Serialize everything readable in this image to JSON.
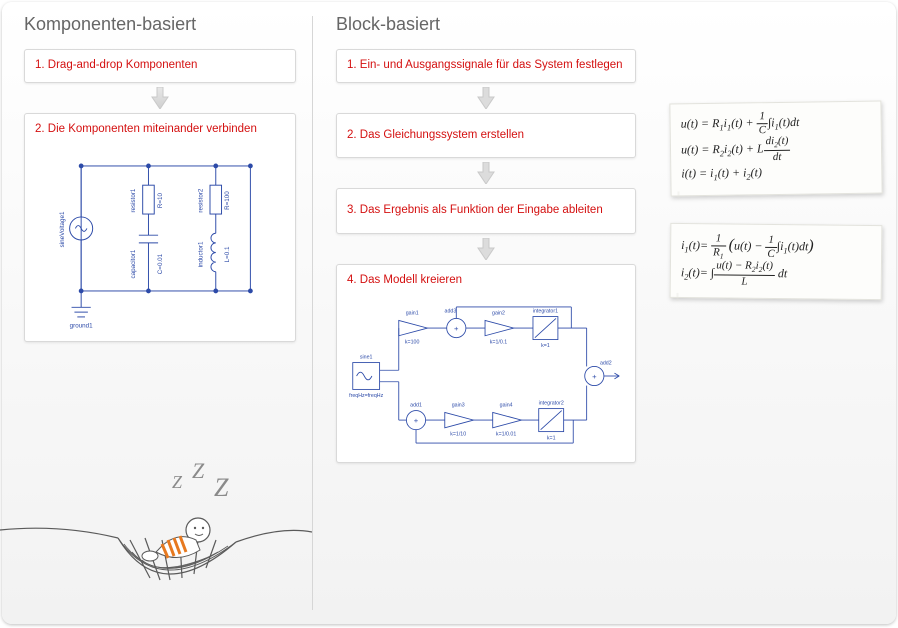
{
  "left": {
    "title": "Komponenten-basiert",
    "steps": [
      "1. Drag-and-drop Komponenten",
      "2. Die Komponenten miteinander verbinden"
    ],
    "circuit_labels": {
      "source": "sineVoltage1",
      "ground": "ground1",
      "r1": "resistor1",
      "c1": "capacitor1",
      "r1v": "R=10",
      "c1v": "C=0.01",
      "l1": "inductor1",
      "r2": "resistor2",
      "l1v": "L=0.1",
      "r2v": "R=100"
    }
  },
  "right": {
    "title": "Block-basiert",
    "steps": [
      "1. Ein- und Ausgangssignale für das System festlegen",
      "2. Das Gleichungssystem erstellen",
      "3. Das Ergebnis als Funktion der Eingabe ableiten",
      "4. Das Modell kreieren"
    ],
    "equations_note1": [
      "u(t) = R₁i₁(t) + (1/C)·∫ i₁(t) dt",
      "u(t) = R₂i₂(t) + L·di₂(t)/dt",
      "i(t) = i₁(t) + i₂(t)"
    ],
    "equations_note2": [
      "i₁(t) = (1/R₁)·( u(t) − (1/C)·∫ i₁(t) dt )",
      "i₂(t) = ∫ (u(t) − R₂i₂(t)) / L · dt"
    ],
    "block_labels": {
      "sine": "sine1",
      "sine_sub": "freqHz=freqHz",
      "gain1": "gain1",
      "gain1_sub": "k=100",
      "add3": "add3",
      "gain2": "gain2",
      "gain2_sub": "k=1/0.1",
      "int1": "integrator1",
      "int1_sub": "k=1",
      "add2": "add2",
      "add1": "add1",
      "gain3": "gain3",
      "gain3_sub": "k=1/10",
      "gain4": "gain4",
      "gain4_sub": "k=1/0.01",
      "int2": "integrator2",
      "int2_sub": "k=1"
    }
  }
}
